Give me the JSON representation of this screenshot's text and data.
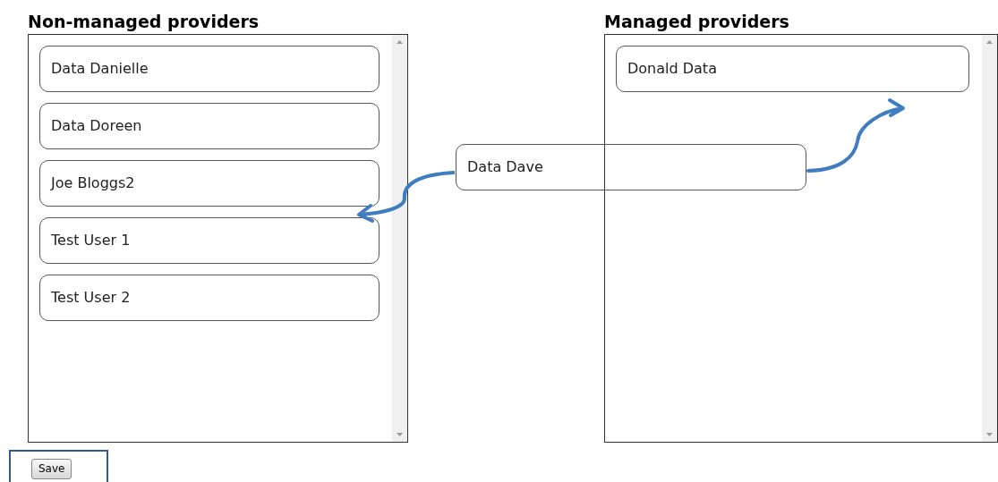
{
  "lists": [
    {
      "heading": "Non-managed providers",
      "items": [
        "Data Danielle",
        "Data Doreen",
        "Joe Bloggs2",
        "Test User 1",
        "Test User 2"
      ]
    },
    {
      "heading": "Managed providers",
      "items": [
        "Donald Data"
      ]
    }
  ],
  "dragged_item": {
    "label": "Data Dave"
  },
  "save_button": {
    "label": "Save"
  }
}
